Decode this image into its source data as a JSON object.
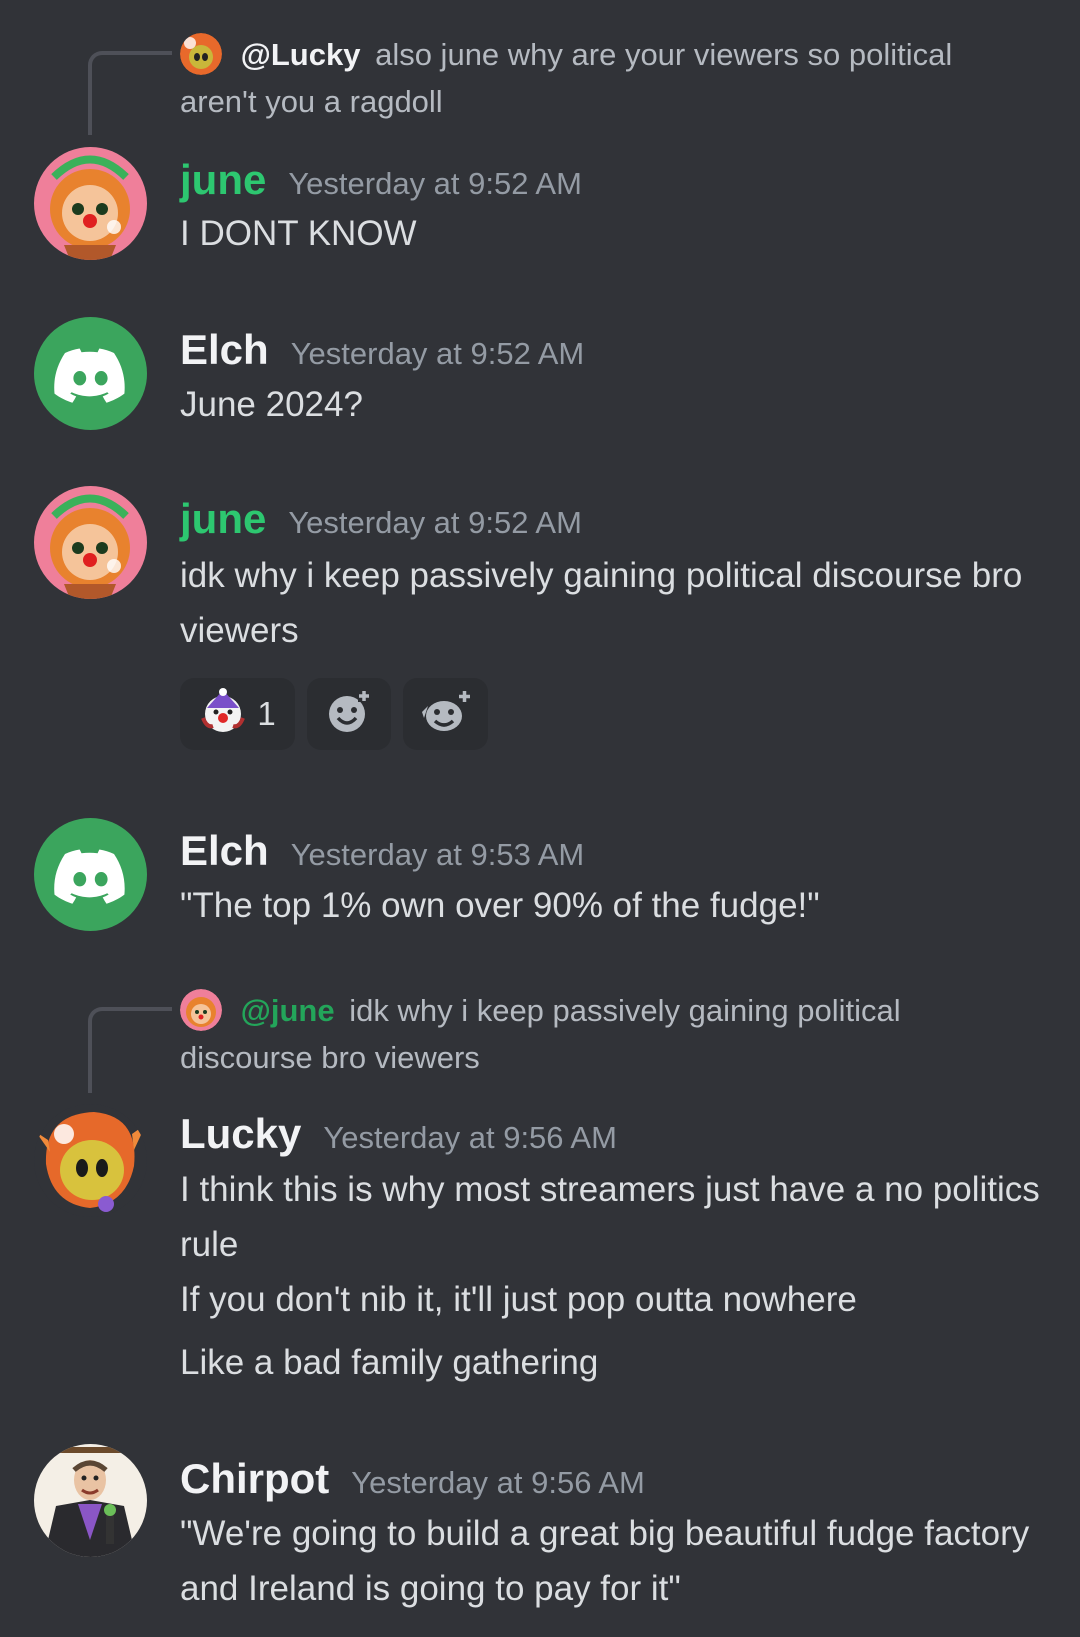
{
  "messages": [
    {
      "reply": {
        "mention": "@Lucky",
        "text": "also june why are your viewers so political aren't you a ragdoll"
      },
      "username": "june",
      "timestamp": "Yesterday at 9:52 AM",
      "lines": [
        "I DONT KNOW"
      ]
    },
    {
      "username": "Elch",
      "timestamp": "Yesterday at 9:52 AM",
      "lines": [
        "June 2024?"
      ]
    },
    {
      "username": "june",
      "timestamp": "Yesterday at 9:52 AM",
      "lines": [
        "idk why i keep passively gaining political discourse bro viewers"
      ],
      "reactions": [
        {
          "emoji": "clown-emoji",
          "count": "1"
        },
        {
          "emoji": "add-reaction-icon"
        },
        {
          "emoji": "add-super-reaction-icon"
        }
      ]
    },
    {
      "username": "Elch",
      "timestamp": "Yesterday at 9:53 AM",
      "lines": [
        "\"The top 1% own over 90% of the fudge!\""
      ]
    },
    {
      "reply": {
        "mention": "@june",
        "text": "idk why i keep passively gaining political discourse bro viewers"
      },
      "username": "Lucky",
      "timestamp": "Yesterday at 9:56 AM",
      "lines": [
        "I think this is why most streamers just have a no politics rule",
        "If you don't nib it, it'll just pop outta nowhere",
        "Like a bad family gathering"
      ]
    },
    {
      "username": "Chirpot",
      "timestamp": "Yesterday at 9:56 AM",
      "lines": [
        "\"We're going to build a great big beautiful fudge factory and Ireland is going to pay for it\""
      ]
    }
  ],
  "colors": {
    "background": "#313338",
    "june_name": "#2dc770",
    "discord_green": "#3ba55d",
    "timestamp": "#949ba4"
  }
}
